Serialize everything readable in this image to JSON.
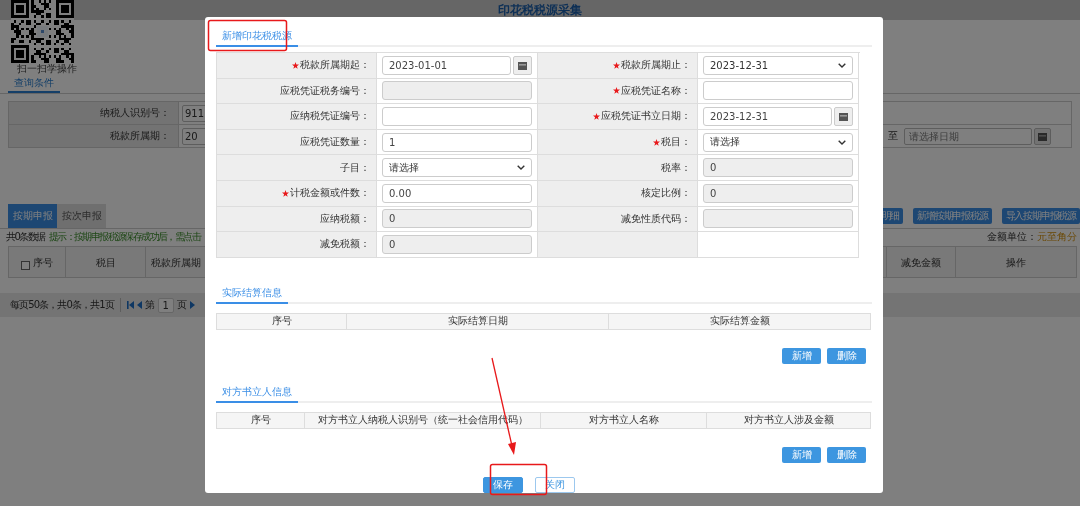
{
  "page_title": "印花税税源采集",
  "qr_caption": "扫一扫学操作",
  "query_tab": "查询条件",
  "query_form": [
    {
      "label": "纳税人识别号：",
      "value": "911"
    },
    {
      "label": "税款所属期：",
      "value": "20",
      "range_label": "至",
      "range_placeholder": "请选择日期"
    }
  ],
  "declare_tabs": [
    {
      "label": "按期申报",
      "selected": true
    },
    {
      "label": "按次申报",
      "selected": false
    }
  ],
  "action_buttons": [
    "明细",
    "新增按期申报税源",
    "导入按期申报税源"
  ],
  "record_count": "共0条数据",
  "hint": "提示：按期申报税源保存成功后，需点击",
  "amount_unit": {
    "label": "金额单位：",
    "value": "元至角分"
  },
  "list_table": {
    "select_all": {
      "checked": false
    },
    "columns": [
      "序号",
      "税目",
      "税款所属期",
      "减免金额",
      "操作"
    ]
  },
  "pager": {
    "summary": "每页50条，共0条，共1页",
    "page_prefix": "第",
    "page": "1",
    "page_suffix": "页"
  },
  "modal": {
    "tab": "新增印花税税源",
    "fields": [
      {
        "label": "税款所属期起：",
        "required": true,
        "kind": "date",
        "value": "2023-01-01"
      },
      {
        "label": "税款所属期止：",
        "required": true,
        "kind": "select",
        "value": "2023-12-31"
      },
      {
        "label": "应税凭证税务编号：",
        "required": false,
        "kind": "readonly"
      },
      {
        "label": "应税凭证名称：",
        "required": true,
        "kind": "text"
      },
      {
        "label": "应纳税凭证编号：",
        "required": false,
        "kind": "text"
      },
      {
        "label": "应税凭证书立日期：",
        "required": true,
        "kind": "date",
        "value": "2023-12-31"
      },
      {
        "label": "应税凭证数量：",
        "required": false,
        "kind": "text",
        "value": "1"
      },
      {
        "label": "税目：",
        "required": true,
        "kind": "select",
        "value": "请选择"
      },
      {
        "label": "子目：",
        "required": false,
        "kind": "select",
        "value": "请选择"
      },
      {
        "label": "税率：",
        "required": false,
        "kind": "readonly",
        "value": "0"
      },
      {
        "label": "计税金额或件数：",
        "required": true,
        "kind": "text",
        "value": "0.00"
      },
      {
        "label": "核定比例：",
        "required": false,
        "kind": "readonly",
        "value": "0"
      },
      {
        "label": "应纳税额：",
        "required": false,
        "kind": "readonly",
        "value": "0"
      },
      {
        "label": "减免性质代码：",
        "required": false,
        "kind": "readonly"
      },
      {
        "label": "减免税额：",
        "required": false,
        "kind": "readonly",
        "value": "0"
      },
      {
        "kind": "blank"
      }
    ],
    "sections": [
      {
        "tab": "实际结算信息",
        "columns": [
          "序号",
          "实际结算日期",
          "实际结算金额"
        ],
        "buttons": [
          "新增",
          "删除"
        ]
      },
      {
        "tab": "对方书立人信息",
        "columns": [
          "序号",
          "对方书立人纳税人识别号（统一社会信用代码）",
          "对方书立人名称",
          "对方书立人涉及金额"
        ],
        "buttons": [
          "新增",
          "删除"
        ]
      }
    ],
    "footer_buttons": [
      {
        "label": "保存",
        "kind": "primary"
      },
      {
        "label": "关闭",
        "kind": "secondary"
      }
    ]
  }
}
